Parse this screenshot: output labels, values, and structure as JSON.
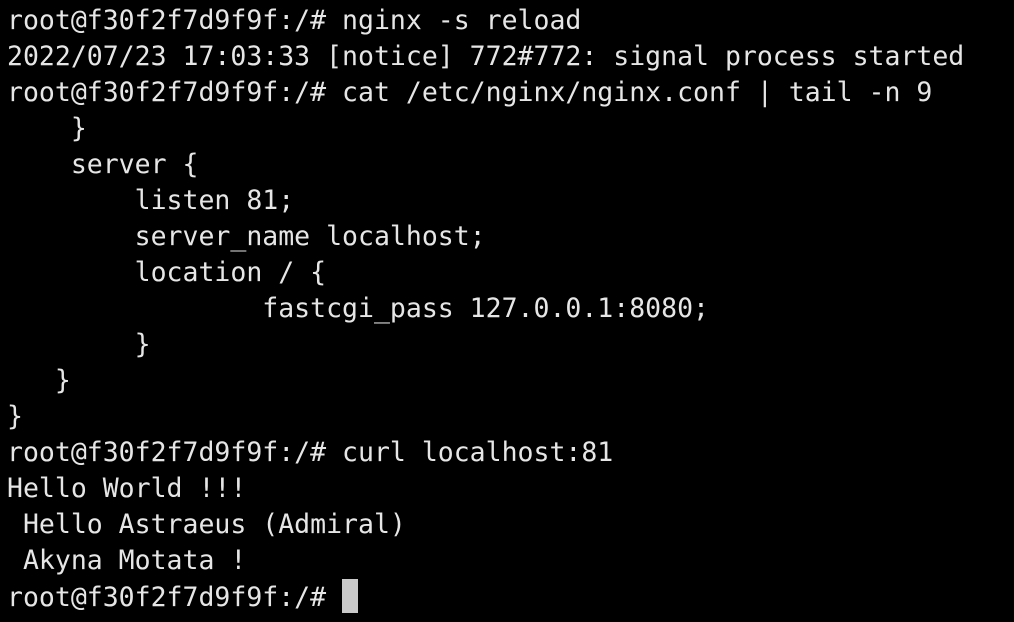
{
  "terminal": {
    "colors": {
      "background": "#000000",
      "text": "#e6e6e6",
      "cursor": "#c9c9c9"
    },
    "lines": [
      "root@f30f2f7d9f9f:/# nginx -s reload",
      "2022/07/23 17:03:33 [notice] 772#772: signal process started",
      "root@f30f2f7d9f9f:/# cat /etc/nginx/nginx.conf | tail -n 9",
      "    }",
      "    server {",
      "        listen 81;",
      "        server_name localhost;",
      "        location / {",
      "                fastcgi_pass 127.0.0.1:8080;",
      "        }",
      "   }",
      "}",
      "root@f30f2f7d9f9f:/# curl localhost:81",
      "Hello World !!!",
      " Hello Astraeus (Admiral)",
      " Akyna Motata !"
    ],
    "prompt": "root@f30f2f7d9f9f:/# "
  }
}
